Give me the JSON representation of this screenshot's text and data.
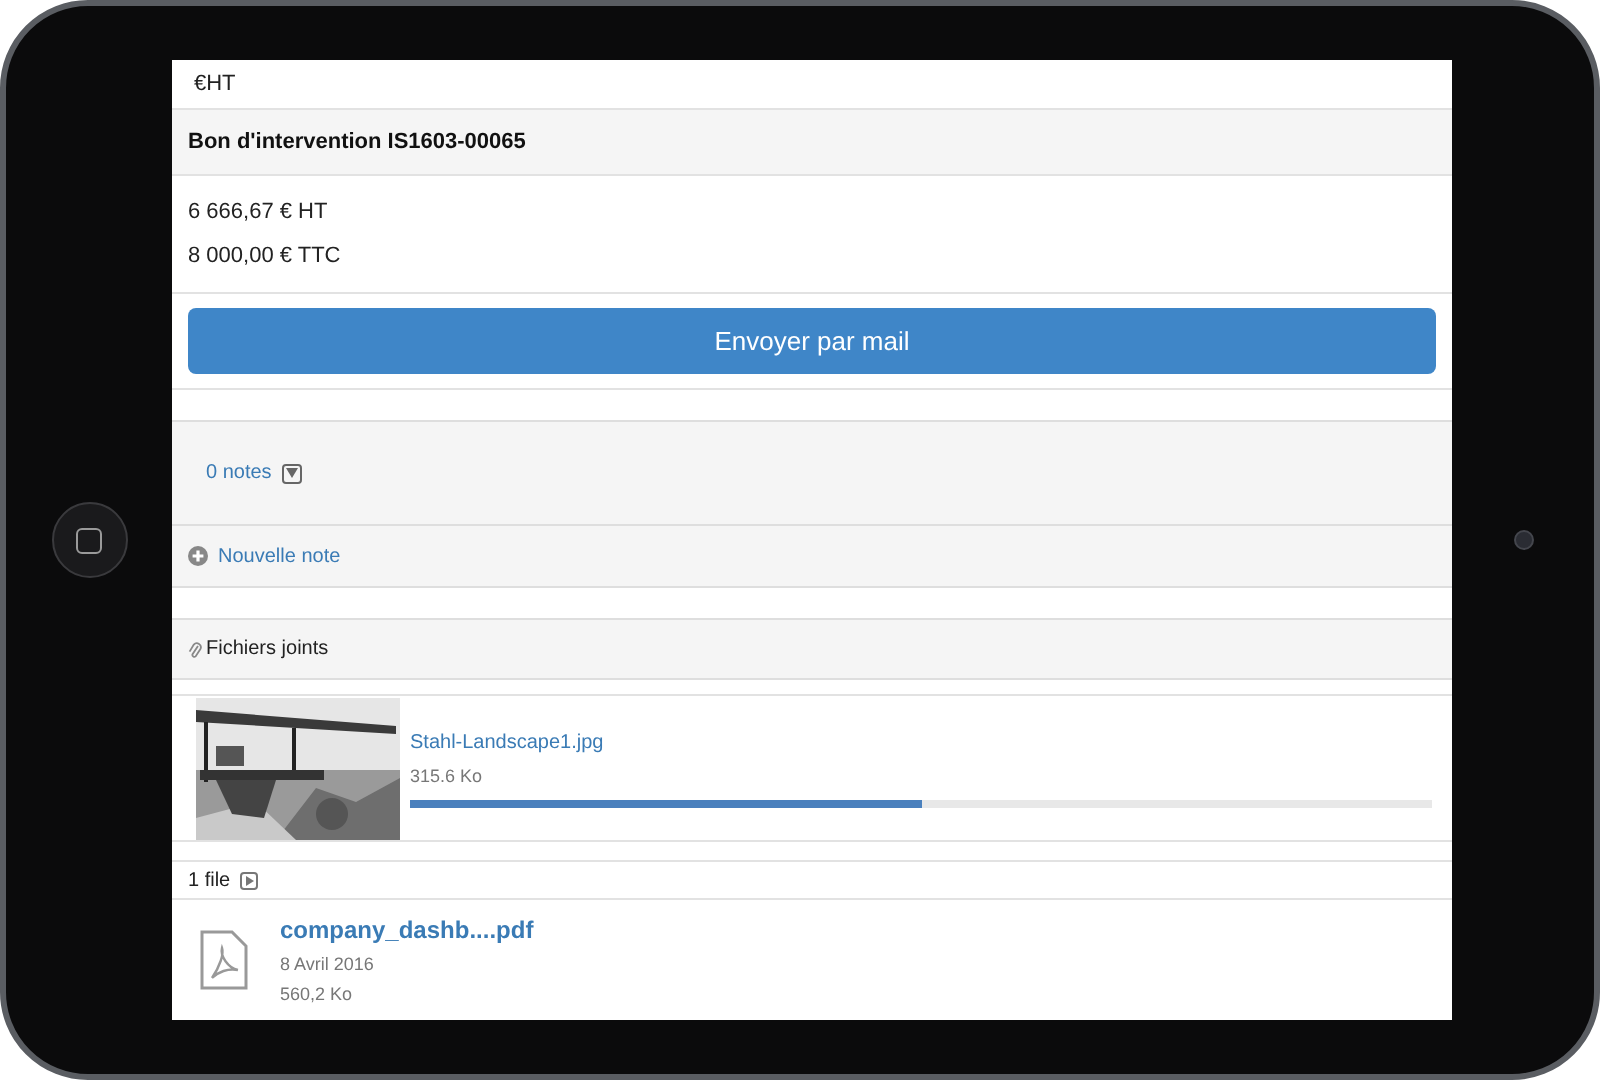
{
  "top_row": {
    "text": "€HT"
  },
  "document": {
    "title": "Bon d'intervention IS1603-00065",
    "amounts": [
      "6 666,67 € HT",
      "8 000,00 € TTC"
    ]
  },
  "send_button": {
    "label": "Envoyer par mail"
  },
  "notes": {
    "label": "0 notes",
    "new_note": "Nouvelle note"
  },
  "attachments": {
    "title": "Fichiers joints",
    "upload": {
      "kind": "picture",
      "name": "Stahl-Landscape1.jpg",
      "size": "315.6 Ko",
      "level": 0.5
    },
    "count": "1 file",
    "files": [
      {
        "name": "company_dashb....pdf",
        "date": "8 Avril 2016",
        "size": "560,2 Ko"
      }
    ]
  }
}
